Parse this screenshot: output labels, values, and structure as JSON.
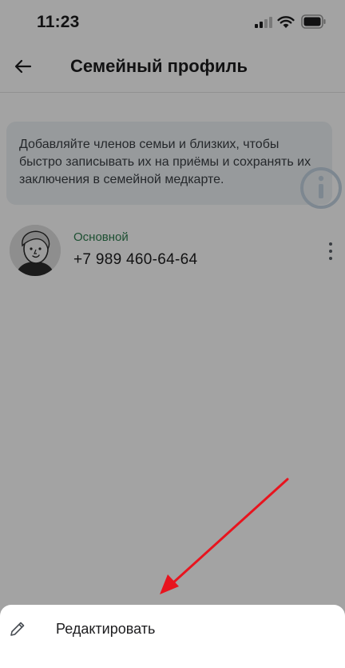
{
  "status_bar": {
    "time": "11:23",
    "icons": [
      "signal-icon",
      "wifi-icon",
      "battery-icon"
    ]
  },
  "header": {
    "title": "Семейный профиль",
    "back_icon": "back-arrow-icon"
  },
  "info_banner": {
    "text": "Добавляйте членов семьи и близких, чтобы быстро записывать их на приёмы и сохранять их заключения в семейной медкарте.",
    "icon": "info-icon"
  },
  "member": {
    "role": "Основной",
    "phone": "+7 989 460-64-64",
    "avatar": "avatar-illustration",
    "menu_icon": "more-vertical-icon"
  },
  "bottom_sheet": {
    "edit_label": "Редактировать",
    "edit_icon": "pencil-icon"
  },
  "colors": {
    "role_green": "#2e7d4f",
    "banner_bg": "#edf1f5",
    "overlay": "rgba(0,0,0,0.36)",
    "annotation_red": "#e8141e"
  }
}
